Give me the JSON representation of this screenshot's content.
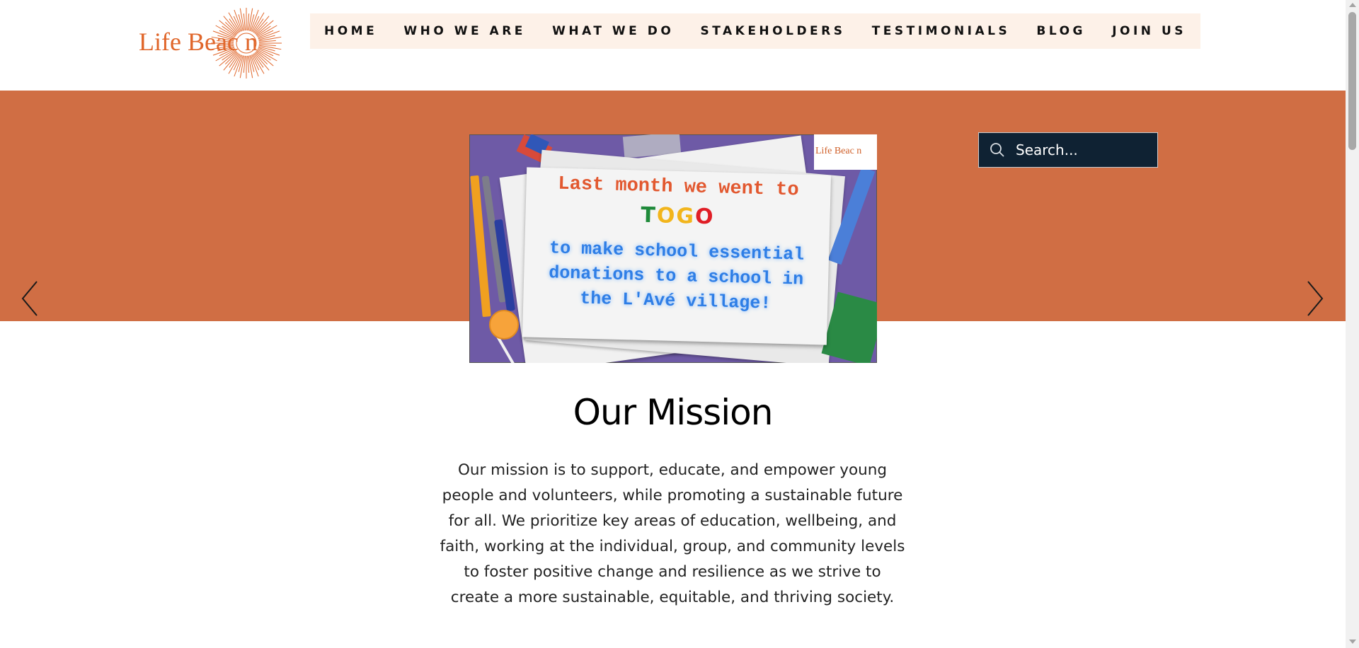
{
  "logo": {
    "text": "Life Beac   n",
    "brand_color": "#e0662a"
  },
  "nav": {
    "items": [
      {
        "label": "HOME"
      },
      {
        "label": "WHO WE ARE"
      },
      {
        "label": "WHAT WE DO"
      },
      {
        "label": "STAKEHOLDERS"
      },
      {
        "label": "TESTIMONIALS"
      },
      {
        "label": "BLOG"
      },
      {
        "label": "JOIN US"
      }
    ]
  },
  "hero": {
    "band_color": "#d06e44",
    "slide": {
      "logo_text": "Life Beac  n",
      "line1": "Last month we went to",
      "togo": [
        {
          "char": "T",
          "color": "#1f8a3a"
        },
        {
          "char": "O",
          "color": "#f2b51c"
        },
        {
          "char": "G",
          "color": "#f2b51c"
        },
        {
          "char": "O",
          "color": "#e01e26"
        }
      ],
      "line2": "to make school essential donations to a school in the L'Avé village!"
    },
    "prev_icon": "chevron-left-icon",
    "next_icon": "chevron-right-icon"
  },
  "search": {
    "placeholder": "Search...",
    "icon": "search-icon"
  },
  "mission": {
    "title": "Our Mission",
    "text": "Our mission is to support, educate, and empower young people and volunteers, while promoting a sustainable future for all. We prioritize key areas of education, wellbeing, and faith, working at the individual, group, and community levels to foster positive change and resilience as we strive to create a more sustainable, equitable, and thriving society."
  }
}
